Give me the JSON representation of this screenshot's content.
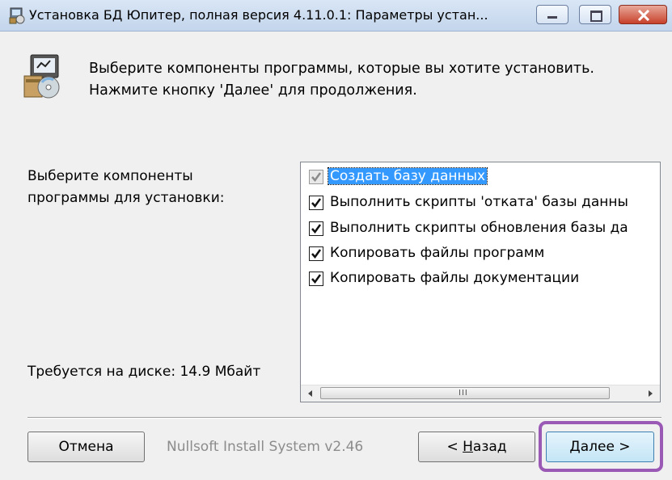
{
  "window": {
    "title": "Установка БД Юпитер, полная версия 4.11.0.1: Параметры устан...",
    "icons": [
      "installer-app-icon",
      "minimize-icon",
      "maximize-icon",
      "close-icon"
    ],
    "close_color": "#c7412b"
  },
  "header": {
    "line1": "Выберите компоненты программы, которые вы хотите установить.",
    "line2": "Нажмите кнопку 'Далее' для продолжения.",
    "icon": "installer-package-icon"
  },
  "left": {
    "label_line1": "Выберите компоненты",
    "label_line2": "программы для установки:",
    "space_required": "Требуется на диске: 14.9 Мбайт"
  },
  "components": [
    {
      "label": "Создать базу данных",
      "checked": true,
      "disabled": true,
      "selected": true
    },
    {
      "label": "Выполнить скрипты 'отката' базы данны",
      "checked": true,
      "disabled": false,
      "selected": false
    },
    {
      "label": "Выполнить скрипты обновления базы да",
      "checked": true,
      "disabled": false,
      "selected": false
    },
    {
      "label": "Копировать файлы программ",
      "checked": true,
      "disabled": false,
      "selected": false
    },
    {
      "label": "Копировать файлы документации",
      "checked": true,
      "disabled": false,
      "selected": false
    }
  ],
  "scrollbar": {
    "grip": "III"
  },
  "footer": {
    "cancel_label": "Отмена",
    "branding": "Nullsoft Install System v2.46",
    "back_prefix": "< ",
    "back_accel": "Н",
    "back_rest": "азад",
    "next_accel": "Д",
    "next_rest": "алее >",
    "highlight_color": "#9b59b6"
  }
}
